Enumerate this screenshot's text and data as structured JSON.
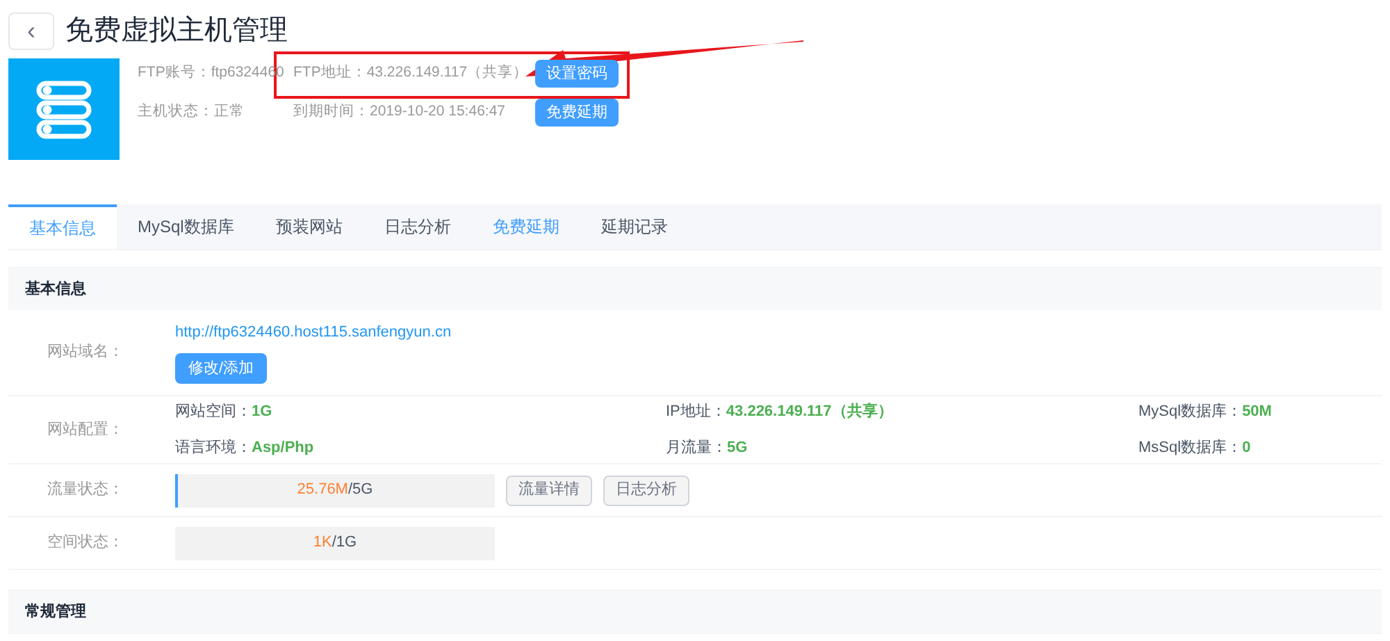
{
  "header": {
    "back_icon": "‹",
    "title": "免费虚拟主机管理"
  },
  "host_info": [
    {
      "label": "FTP账号：",
      "value": "ftp6324460"
    },
    {
      "label": "FTP地址：",
      "value": "43.226.149.117（共享）"
    },
    {
      "label": "主机状态：",
      "value": "正常"
    },
    {
      "label": "到期时间：",
      "value": "2019-10-20 15:46:47"
    }
  ],
  "host_buttons": [
    "设置密码",
    "免费延期"
  ],
  "tabs": [
    {
      "label": "基本信息",
      "selected": true,
      "highlight": false
    },
    {
      "label": "MySql数据库",
      "selected": false,
      "highlight": false
    },
    {
      "label": "预装网站",
      "selected": false,
      "highlight": false
    },
    {
      "label": "日志分析",
      "selected": false,
      "highlight": false
    },
    {
      "label": "免费延期",
      "selected": false,
      "highlight": true
    },
    {
      "label": "延期记录",
      "selected": false,
      "highlight": false
    }
  ],
  "basic_section": {
    "title": "基本信息",
    "domain": {
      "label": "网站域名：",
      "link": "http://ftp6324460.host115.sanfengyun.cn",
      "button": "修改/添加"
    },
    "config": {
      "label": "网站配置：",
      "items": [
        {
          "label": "网站空间：",
          "value": "1G"
        },
        {
          "label": "IP地址：",
          "value": "43.226.149.117（共享）"
        },
        {
          "label": "MySql数据库：",
          "value": "50M"
        },
        {
          "label": "语言环境：",
          "value": "Asp/Php"
        },
        {
          "label": "月流量：",
          "value": "5G"
        },
        {
          "label": "MsSql数据库：",
          "value": "0"
        }
      ]
    },
    "meters": [
      {
        "label": "流量状态：",
        "used": "25.76M",
        "total": "/5G",
        "level": 0.005,
        "buttons": [
          "流量详情",
          "日志分析"
        ]
      },
      {
        "label": "空间状态：",
        "used": "1K",
        "total": "/1G",
        "level": 0
      }
    ]
  },
  "general_section": {
    "title": "常规管理"
  }
}
